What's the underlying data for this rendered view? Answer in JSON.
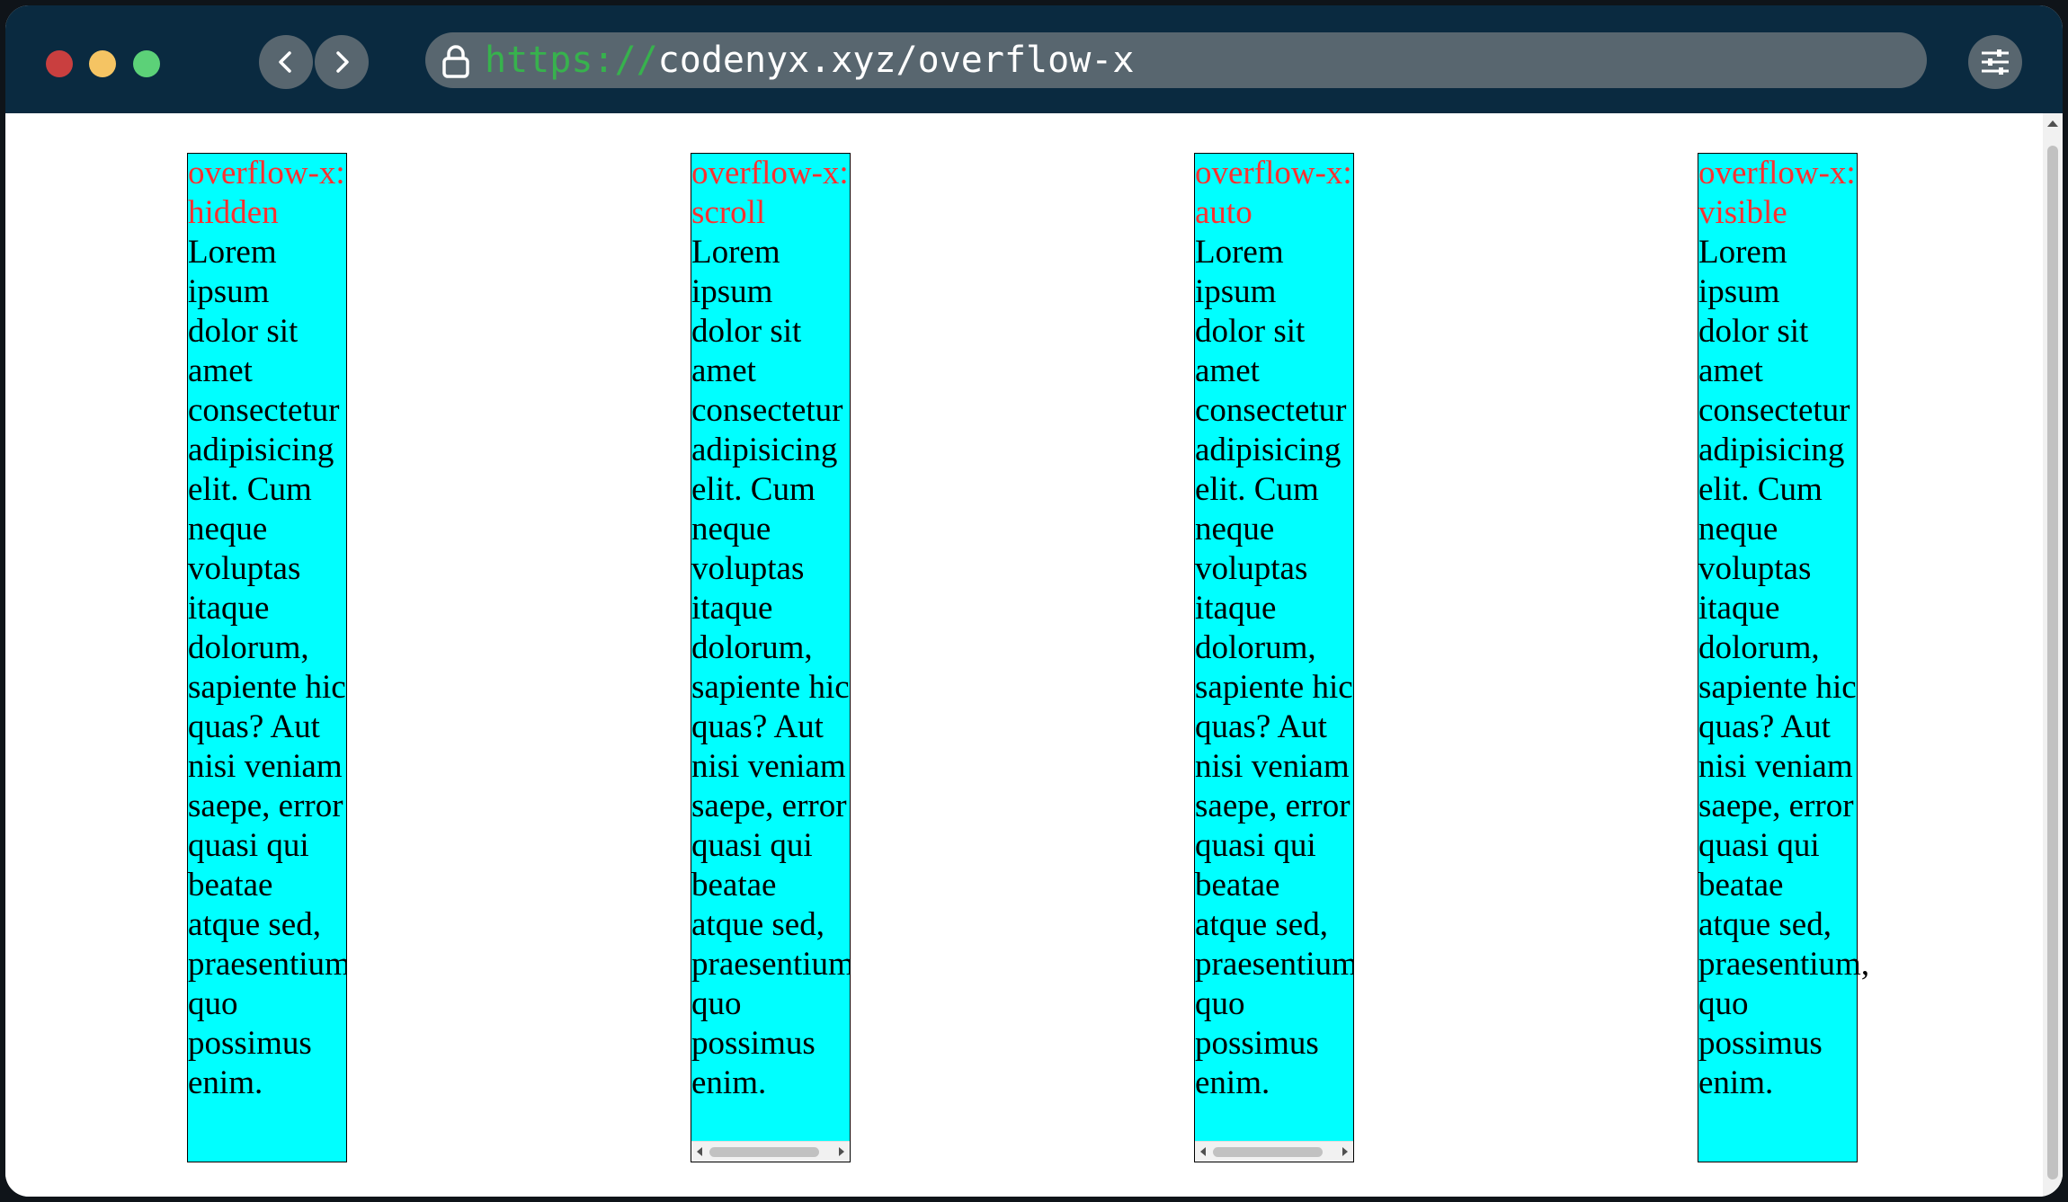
{
  "browser": {
    "url_scheme": "https://",
    "url_host": "codenyx.xyz/overflow-x",
    "window_colors": {
      "titlebar": "#0a2a40",
      "close": "#c93f3f",
      "minimize": "#f5c463",
      "maximize": "#5cd178",
      "url_scheme_color": "#37b24d"
    }
  },
  "page": {
    "body_text": "Lorem ipsum dolor sit amet consectetur adipisicing elit. Cum neque voluptas itaque dolorum, sapiente hic quas? Aut nisi veniam saepe, error quasi qui beatae atque sed, praesentium, quo possimus enim.",
    "box_color": "#00ffff",
    "heading_color": "#ff3030",
    "boxes": [
      {
        "heading": "overflow-x: hidden",
        "body": "Lorem ipsum dolor sit amet consectetur adipisicing elit. Cum neque voluptas itaque dolorum, sapiente hic quas? Aut nisi veniam saepe, error quasi qui beatae atque sed, praesentium, quo possimus enim."
      },
      {
        "heading": "overflow-x: scroll",
        "body": "Lorem ipsum dolor sit amet consectetur adipisicing elit. Cum neque voluptas itaque dolorum, sapiente hic quas? Aut nisi veniam saepe, error quasi qui beatae atque sed, praesentium, quo possimus enim."
      },
      {
        "heading": "overflow-x: auto",
        "body": "Lorem ipsum dolor sit amet consectetur adipisicing elit. Cum neque voluptas itaque dolorum, sapiente hic quas? Aut nisi veniam saepe, error quasi qui beatae atque sed, praesentium, quo possimus enim."
      },
      {
        "heading": "overflow-x: visible",
        "body": "Lorem ipsum dolor sit amet consectetur adipisicing elit. Cum neque voluptas itaque dolorum, sapiente hic quas? Aut nisi veniam saepe, error quasi qui beatae atque sed, praesentium, quo possimus enim."
      }
    ]
  }
}
